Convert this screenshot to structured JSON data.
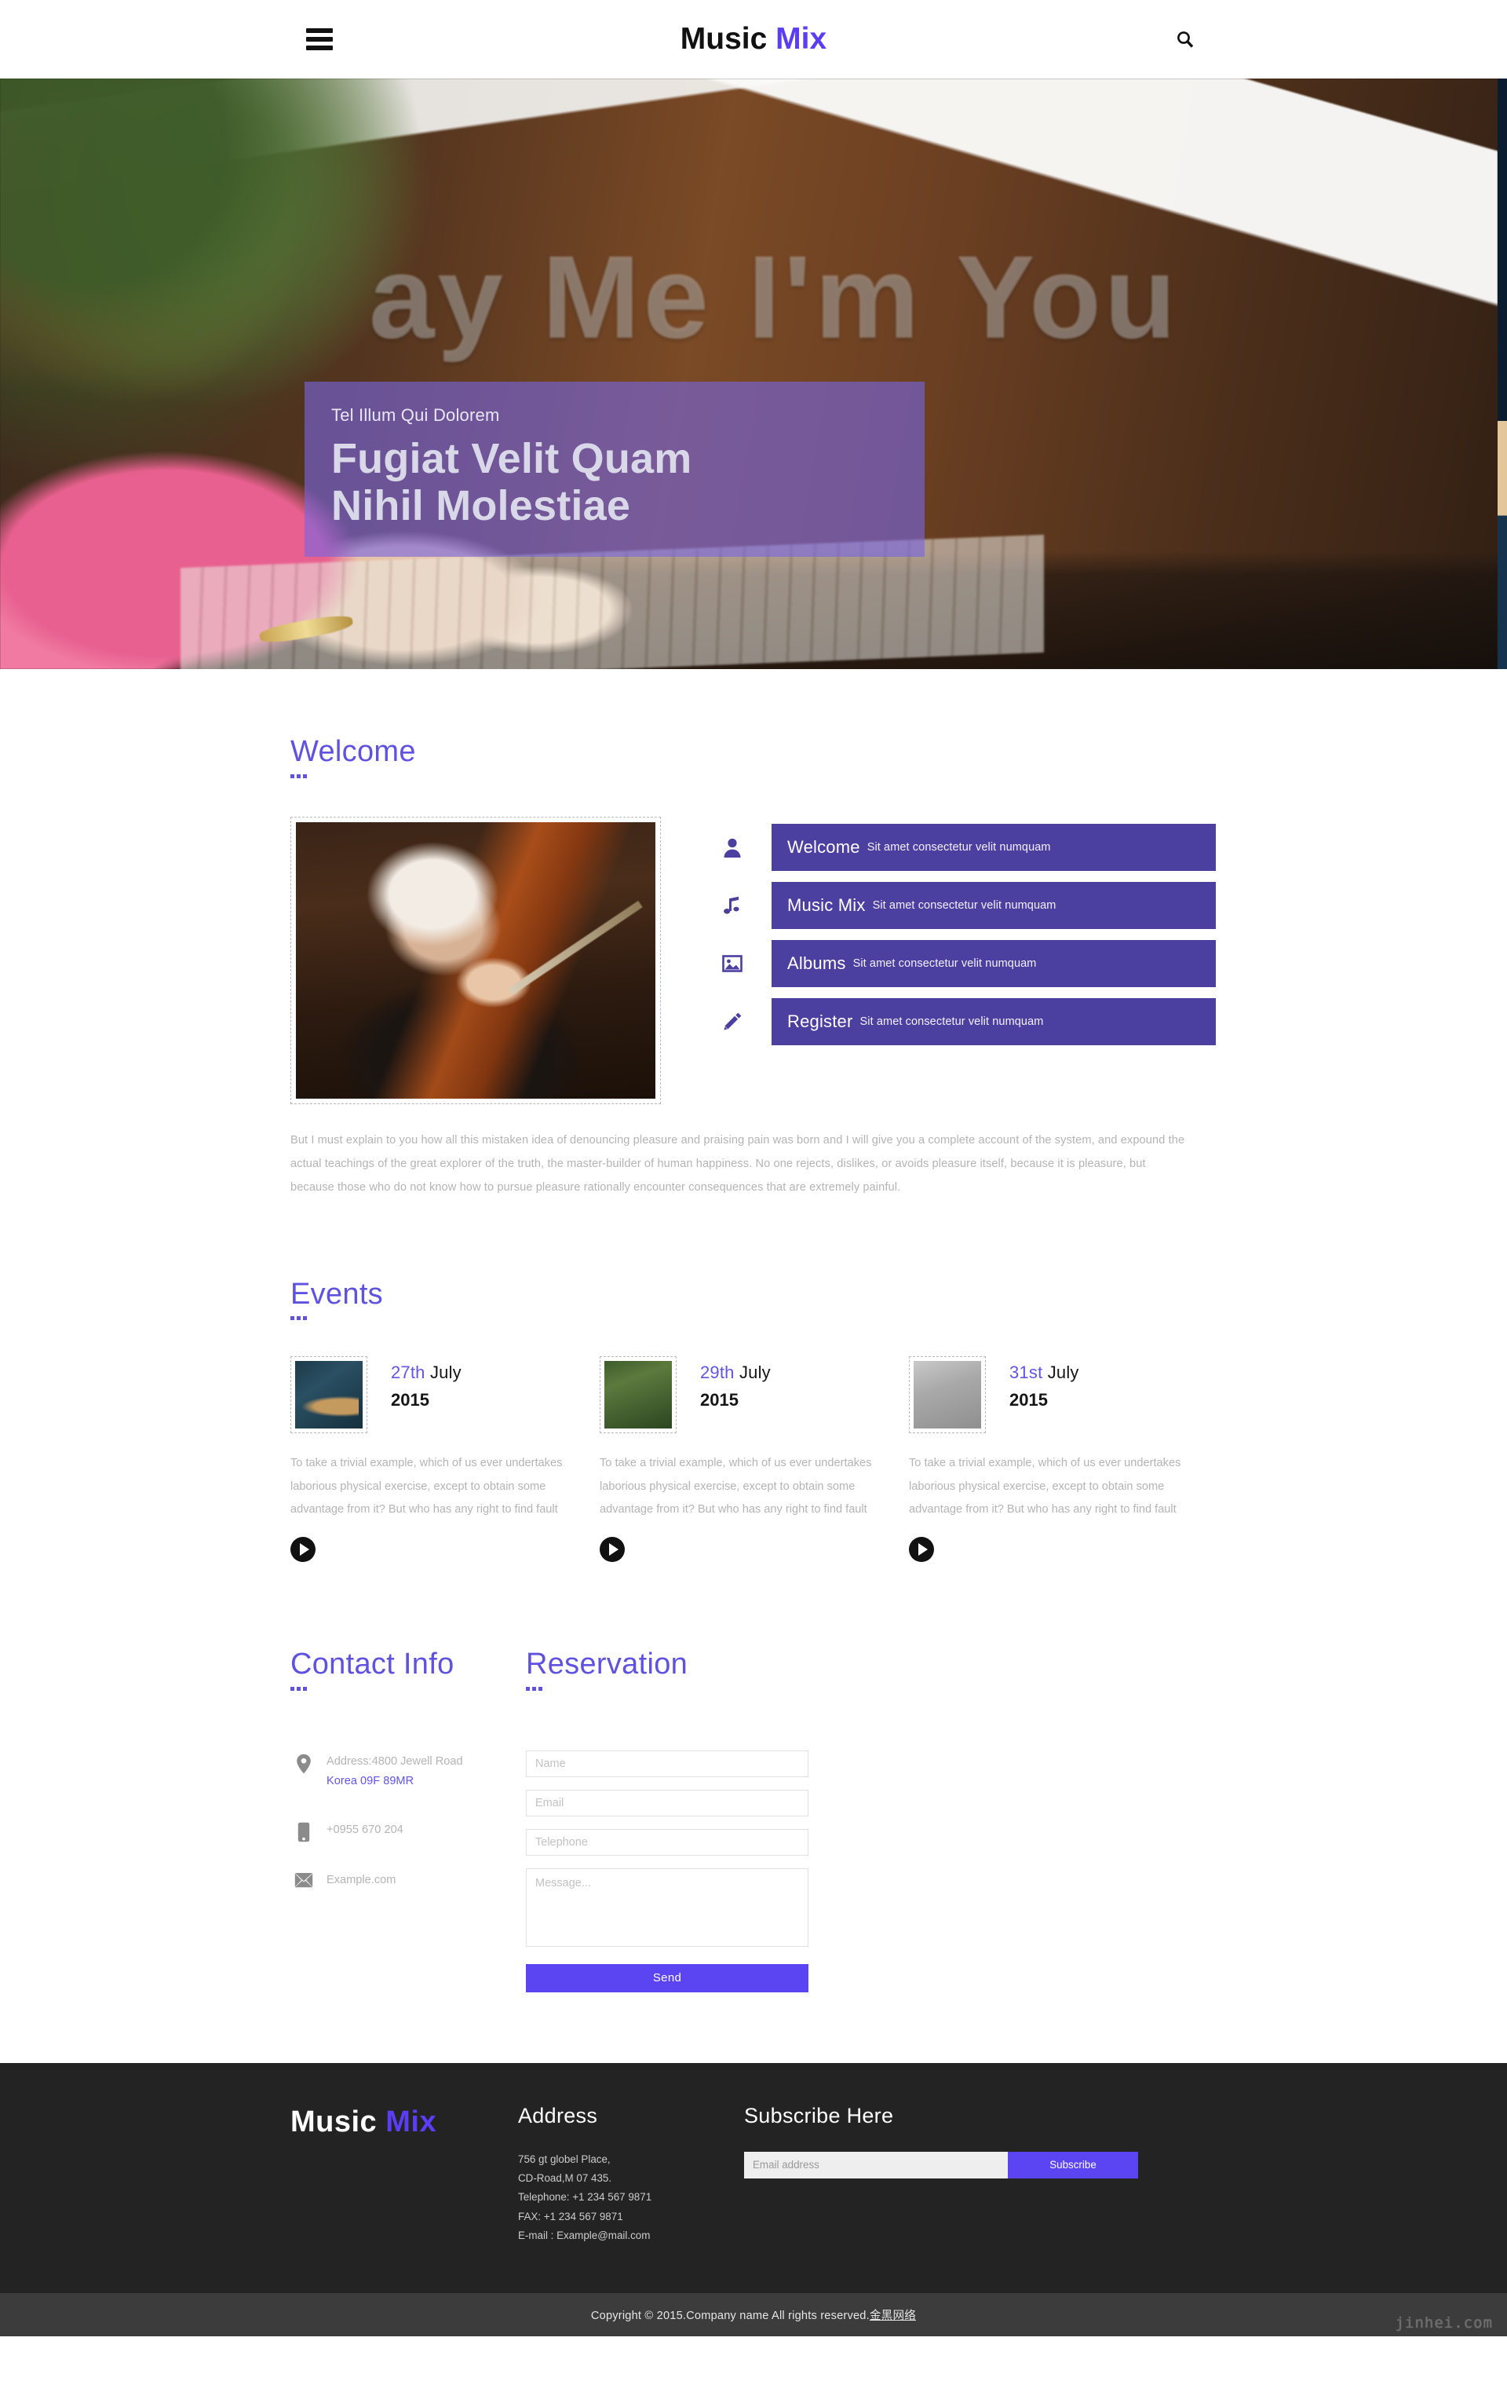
{
  "header": {
    "brand_first": "Music",
    "brand_second": "Mix",
    "menu_icon": "hamburger-icon",
    "search_icon": "search-icon"
  },
  "hero": {
    "subtitle": "Tel Illum Qui Dolorem",
    "title_line1": "Fugiat Velit Quam",
    "title_line2": "Nihil Molestiae",
    "overlay_color": "#7765e0",
    "background_text": "ay Me I'm You"
  },
  "welcome": {
    "title": "Welcome",
    "features": [
      {
        "icon": "user-icon",
        "name": "Welcome",
        "desc": "Sit amet consectetur velit numquam"
      },
      {
        "icon": "music-note-icon",
        "name": "Music Mix",
        "desc": "Sit amet consectetur velit numquam"
      },
      {
        "icon": "image-icon",
        "name": "Albums",
        "desc": "Sit amet consectetur velit numquam"
      },
      {
        "icon": "pencil-icon",
        "name": "Register",
        "desc": "Sit amet consectetur velit numquam"
      }
    ],
    "paragraph": "But I must explain to you how all this mistaken idea of denouncing pleasure and praising pain was born and I will give you a complete account of the system, and expound the actual teachings of the great explorer of the truth, the master-builder of human happiness. No one rejects, dislikes, or avoids pleasure itself, because it is pleasure, but because those who do not know how to pursue pleasure rationally encounter consequences that are extremely painful."
  },
  "events": {
    "title": "Events",
    "items": [
      {
        "day": "27th",
        "month": "July",
        "year": "2015",
        "text": "To take a trivial example, which of us ever undertakes laborious physical exercise, except to obtain some advantage from it? But who has any right to find fault"
      },
      {
        "day": "29th",
        "month": "July",
        "year": "2015",
        "text": "To take a trivial example, which of us ever undertakes laborious physical exercise, except to obtain some advantage from it? But who has any right to find fault"
      },
      {
        "day": "31st",
        "month": "July",
        "year": "2015",
        "text": "To take a trivial example, which of us ever undertakes laborious physical exercise, except to obtain some advantage from it? But who has any right to find fault"
      }
    ]
  },
  "contact": {
    "title": "Contact Info",
    "address_line1": "Address:4800 Jewell Road",
    "address_line2": "Korea 09F 89MR",
    "phone": "+0955 670 204",
    "email": "Example.com"
  },
  "reservation": {
    "title": "Reservation",
    "name_placeholder": "Name",
    "email_placeholder": "Email",
    "telephone_placeholder": "Telephone",
    "message_placeholder": "Message...",
    "name_value": "",
    "email_value": "",
    "telephone_value": "",
    "message_value": "",
    "send_label": "Send",
    "send_color": "#5b45f2"
  },
  "footer": {
    "brand_first": "Music",
    "brand_second": "Mix",
    "address_title": "Address",
    "address_lines": "756 gt globel Place,\nCD-Road,M 07 435.\nTelephone: +1 234 567 9871\nFAX: +1 234 567 9871\nE-mail : Example@mail.com",
    "subscribe_title": "Subscribe Here",
    "subscribe_placeholder": "Email address",
    "subscribe_value": "",
    "subscribe_label": "Subscribe",
    "copyright_main": "Copyright © 2015.Company name All rights reserved.",
    "copyright_link": "金黑网络",
    "watermark": "jinhei.com"
  },
  "colors": {
    "accent_heading": "#5f52e0",
    "accent_bar": "#4b3fa0",
    "accent_button": "#5b45f2",
    "brand_accent": "#5b3df6",
    "footer_bg": "#232323",
    "copybar_bg": "#3c3c3c"
  }
}
